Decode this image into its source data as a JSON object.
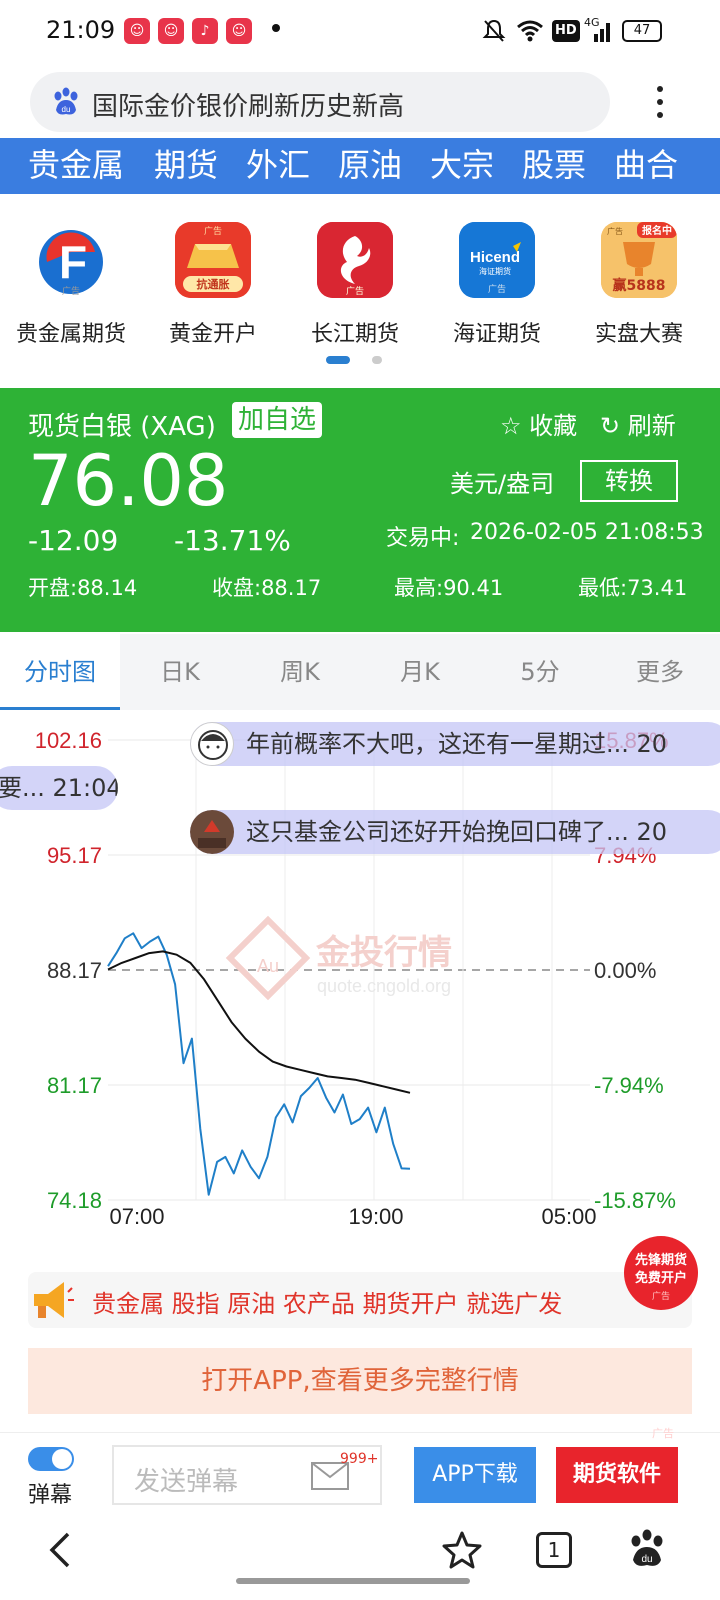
{
  "status_bar": {
    "time": "21:09",
    "battery": "47",
    "network": "4G",
    "hd": "HD",
    "icons": [
      "xiaohongshu-icon",
      "xiaohongshu-icon",
      "ting-icon",
      "xiaohongshu-icon",
      "dot-icon",
      "mute-icon",
      "wifi-icon",
      "hd-icon",
      "signal-icon",
      "battery-icon"
    ]
  },
  "search": {
    "query": "国际金价银价刷新历史新高",
    "icon": "baidu-paw-icon",
    "menu_icon": "more-vertical-icon"
  },
  "categories": [
    "贵金属",
    "期货",
    "外汇",
    "原油",
    "大宗",
    "股票",
    "曲合"
  ],
  "apps": [
    {
      "name": "贵金属期货",
      "icon": "guangfa-logo-icon",
      "ad": "广告"
    },
    {
      "name": "黄金开户",
      "icon": "gold-bar-icon",
      "badge": "广告",
      "sub": "抗通胀"
    },
    {
      "name": "长江期货",
      "icon": "phoenix-logo-icon",
      "ad": "广告"
    },
    {
      "name": "海证期货",
      "icon": "hicend-logo-icon",
      "logo_text": "Hicend",
      "logo_sub": "海证期货",
      "ad": "广告"
    },
    {
      "name": "实盘大赛",
      "icon": "trophy-icon",
      "badge": "报名中",
      "prize": "赢5888",
      "ad": "广告"
    }
  ],
  "quote": {
    "name": "现货白银 (XAG)",
    "add_label": "加自选",
    "favorite_label": "收藏",
    "refresh_label": "刷新",
    "price": "76.08",
    "change": "-12.09",
    "change_pct": "-13.71%",
    "unit": "美元/盎司",
    "convert_label": "转换",
    "status": "交易中:",
    "timestamp": "2026-02-05 21:08:53",
    "open": "开盘:88.14",
    "close": "收盘:88.17",
    "high": "最高:90.41",
    "low": "最低:73.41",
    "bg_color": "#2eb236"
  },
  "tabs": [
    "分时图",
    "日K",
    "周K",
    "月K",
    "5分",
    "更多"
  ],
  "chart_data": {
    "type": "line",
    "y_left_ticks": [
      "102.16",
      "95.17",
      "88.17",
      "81.17",
      "74.18"
    ],
    "y_right_ticks": [
      "15.87%",
      "7.94%",
      "0.00%",
      "-7.94%",
      "-15.87%"
    ],
    "x_ticks": [
      "07:00",
      "19:00",
      "05:00"
    ],
    "baseline": 88.17,
    "ylim": [
      74.18,
      102.16
    ],
    "watermark": "金投行情",
    "watermark_url": "quote.cngold.org",
    "series": [
      {
        "values": [
          88.4,
          89.2,
          90.1,
          90.4,
          89.5,
          89.9,
          90.2,
          89.1,
          87.3,
          82.5,
          84.0,
          78.5,
          74.5,
          76.5,
          76.8,
          75.8,
          77.2,
          76.2,
          75.5,
          76.8,
          79.2,
          80.0,
          78.9,
          80.5,
          81.0,
          81.6,
          80.4,
          79.5,
          80.6,
          78.8,
          79.1,
          79.8,
          78.3,
          79.8,
          77.6,
          76.1,
          76.08
        ]
      },
      {
        "values": [
          88.2,
          88.6,
          88.9,
          89.2,
          89.3,
          89.1,
          88.6,
          87.6,
          86.3,
          85.0,
          84.0,
          83.2,
          82.6,
          82.3,
          82.1,
          81.9,
          81.7,
          81.6,
          81.5,
          81.3,
          81.1,
          80.9,
          80.7
        ]
      }
    ]
  },
  "danmu": [
    {
      "text": "年前概率不大吧，这还有一星期过... 20",
      "avatar": "cartoon-avatar-icon"
    },
    {
      "text": "要... 21:04"
    },
    {
      "text": "这只基金公司还好开始挽回口碑了... 20",
      "avatar": "photo-avatar-icon"
    }
  ],
  "ad_banner": {
    "items": [
      "贵金属",
      "股指",
      "原油",
      "农产品",
      "期货开户",
      "就选广发"
    ],
    "icon": "megaphone-icon",
    "badge_line1": "先锋期货",
    "badge_line2": "免费开户",
    "ad": "广告"
  },
  "open_app": "打开APP,查看更多完整行情",
  "bottom_tool": {
    "danmu_toggle_label": "弹幕",
    "input_placeholder": "发送弹幕",
    "msg_count": "999+",
    "app_download": "APP下载",
    "futures_software": "期货软件",
    "ad": "广告"
  },
  "nav": {
    "tab_count": "1"
  }
}
